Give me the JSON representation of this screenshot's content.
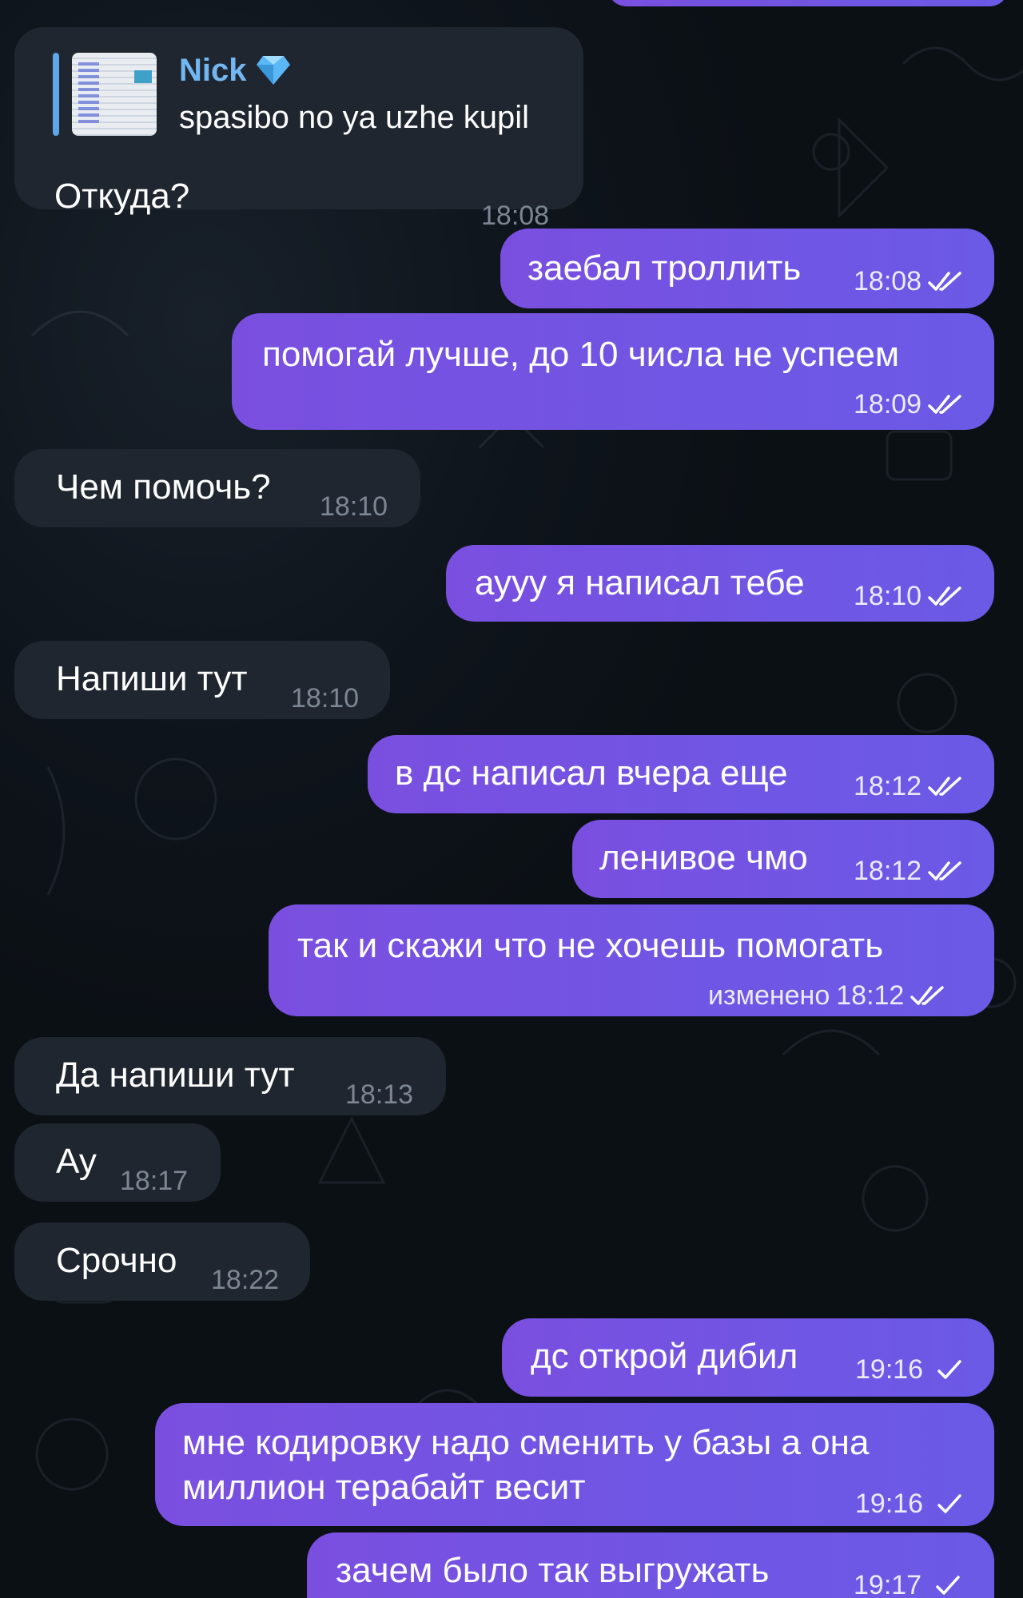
{
  "reply_message": {
    "reply_author": "Nick",
    "reply_text": "spasibo no ya uzhe kupil",
    "text": "Откуда?",
    "time": "18:08"
  },
  "messages": [
    {
      "direction": "out",
      "text": "заебал троллить",
      "time": "18:08",
      "status": "read"
    },
    {
      "direction": "out",
      "text": "помогай лучше, до 10 числа не успеем",
      "time": "18:09",
      "status": "read"
    },
    {
      "direction": "in",
      "text": "Чем помочь?",
      "time": "18:10"
    },
    {
      "direction": "out",
      "text": "аууу я написал тебе",
      "time": "18:10",
      "status": "read"
    },
    {
      "direction": "in",
      "text": "Напиши тут",
      "time": "18:10"
    },
    {
      "direction": "out",
      "text": "в дс написал вчера еще",
      "time": "18:12",
      "status": "read"
    },
    {
      "direction": "out",
      "text": "ленивое чмо",
      "time": "18:12",
      "status": "read"
    },
    {
      "direction": "out",
      "text": "так и скажи что не хочешь помогать",
      "edited_label": "изменено",
      "time": "18:12",
      "status": "read"
    },
    {
      "direction": "in",
      "text": "Да напиши тут",
      "time": "18:13"
    },
    {
      "direction": "in",
      "text": "Ау",
      "time": "18:17"
    },
    {
      "direction": "in",
      "text": "Срочно",
      "time": "18:22"
    },
    {
      "direction": "out",
      "text": "дс открой дибил",
      "time": "19:16",
      "status": "sent"
    },
    {
      "direction": "out",
      "text_line1": "мне кодировку надо сменить у базы а она",
      "text_line2": "миллион терабайт весит",
      "time": "19:16",
      "status": "sent"
    },
    {
      "direction": "out",
      "text": "зачем было так выгружать",
      "time": "19:17",
      "status": "sent"
    }
  ],
  "colors": {
    "outgoing_bubble": "#7155e4",
    "incoming_bubble": "#1f262f",
    "reply_name": "#72b6f2",
    "background": "#0d1218"
  },
  "icons": {
    "premium_badge": "diamond-icon",
    "read_status": "double-check-icon",
    "sent_status": "single-check-icon"
  }
}
